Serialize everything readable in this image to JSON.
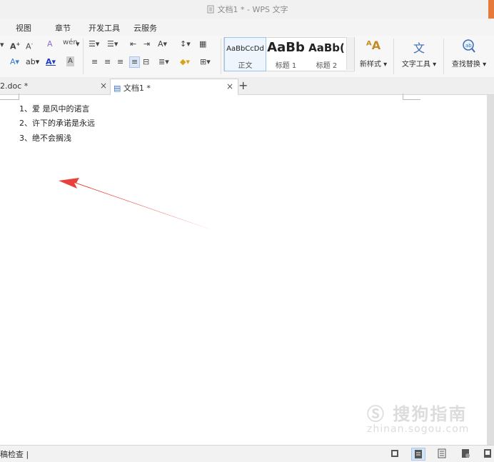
{
  "window": {
    "title": "文档1 * - WPS 文字",
    "accent_color": "#e57a3a"
  },
  "menu": {
    "items": [
      "视图",
      "章节",
      "开发工具",
      "云服务"
    ]
  },
  "ribbon": {
    "styles": [
      {
        "preview": "AaBbCcDd",
        "label": "正文"
      },
      {
        "preview": "AaBb",
        "label": "标题 1"
      },
      {
        "preview": "AaBb(",
        "label": "标题 2"
      }
    ],
    "new_style": "新样式",
    "text_tools": "文字工具",
    "find_replace": "查找替换",
    "wen_glyph": "wén",
    "font_color_letter": "A"
  },
  "tabs": [
    {
      "label": "2.doc *",
      "close": "×"
    },
    {
      "label": "文档1 *",
      "close": "×"
    }
  ],
  "new_tab": "+",
  "document": {
    "lines": [
      "1、爱 是风中的诺言",
      "2、许下的承诺是永远",
      "3、绝不会搁浅"
    ],
    "annotation_arrow_color": "#e8403a"
  },
  "watermark": {
    "brand": "搜狗指南",
    "url": "zhinan.sogou.com"
  },
  "status": {
    "text": "稿检查"
  },
  "icons": [
    "doc-icon",
    "font-grow-icon",
    "font-shrink-icon",
    "clear-format-icon",
    "bullets-icon",
    "numbering-icon",
    "indent-icon",
    "outdent-icon",
    "table-icon",
    "align-left-icon",
    "align-center-icon",
    "align-right-icon",
    "justify-icon",
    "fill-color-icon",
    "border-icon",
    "new-style-icon",
    "text-tools-icon",
    "find-replace-icon",
    "close-icon",
    "add-tab-icon"
  ]
}
